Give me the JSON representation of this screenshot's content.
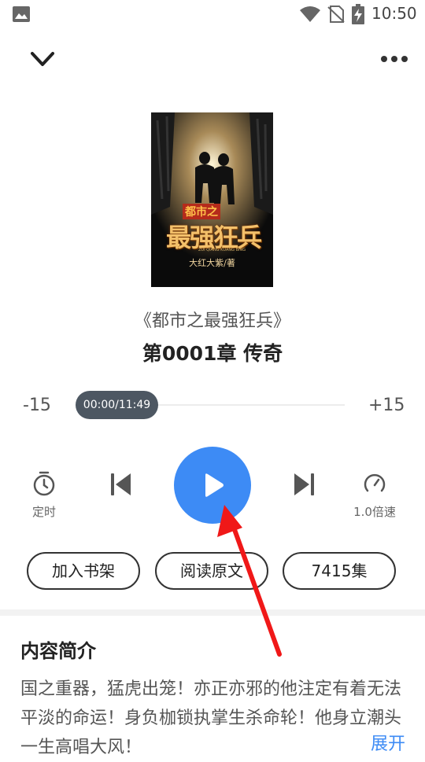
{
  "status_bar": {
    "time": "10:50",
    "icons": [
      "gallery-icon",
      "wifi-icon",
      "no-sim-icon",
      "battery-charging-icon"
    ]
  },
  "top_bar": {
    "collapse_icon": "chevron-down-icon",
    "more_icon": "more-dots-icon"
  },
  "cover": {
    "title_small": "都市之",
    "title_big": "最强狂兵",
    "subtitle_en": "ZUI QIANG KUANG BING",
    "author": "大红大紫/著"
  },
  "book": {
    "name": "《都市之最强狂兵》",
    "chapter": "第0001章 传奇"
  },
  "progress": {
    "rewind_label": "-15",
    "forward_label": "+15",
    "time": "00:00/11:49",
    "fraction": 0.0
  },
  "controls": {
    "timer": {
      "label": "定时",
      "icon": "timer-icon"
    },
    "previous": {
      "icon": "skip-previous-icon"
    },
    "play": {
      "icon": "play-icon"
    },
    "next": {
      "icon": "skip-next-icon"
    },
    "speed": {
      "label": "1.0倍速",
      "icon": "speed-icon"
    }
  },
  "actions": {
    "add_shelf": "加入书架",
    "read_original": "阅读原文",
    "episodes": "7415集"
  },
  "intro": {
    "heading": "内容简介",
    "text": "国之重器，猛虎出笼！亦正亦邪的他注定有着无法平淡的命运！身负枷锁执掌生杀命轮！他身立潮头一生高唱大风！",
    "expand": "展开"
  },
  "colors": {
    "accent": "#3d8bf5",
    "thumb": "#4d5762",
    "arrow": "#f01818"
  }
}
